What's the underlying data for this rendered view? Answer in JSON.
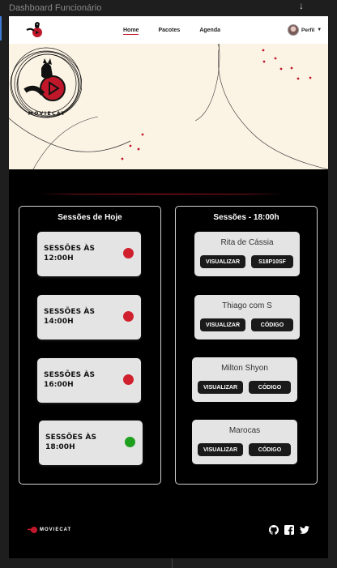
{
  "frame_label": "Dashboard Funcionário",
  "nav": {
    "links": [
      "Home",
      "Pacotes",
      "Agenda"
    ],
    "profile_label": "Perfil"
  },
  "brand": {
    "name": "MOVIECAT",
    "hero_wordmark": "MOVIECAT"
  },
  "colors": {
    "accent": "#c0182a",
    "status_busy": "#d0202e",
    "status_free": "#1ea01e"
  },
  "left_panel": {
    "title": "Sessões de Hoje",
    "sessions": [
      {
        "line1": "SESSÕES ÀS",
        "line2": "12:00H",
        "status": "busy"
      },
      {
        "line1": "SESSÕES ÀS",
        "line2": "14:00H",
        "status": "busy"
      },
      {
        "line1": "SESSÕES ÀS",
        "line2": "16:00H",
        "status": "busy"
      },
      {
        "line1": "SESSÕES ÀS",
        "line2": "18:00H",
        "status": "free"
      }
    ]
  },
  "right_panel": {
    "title": "Sessões - 18:00h",
    "people": [
      {
        "name": "Rita de Cássia",
        "view_label": "VISUALIZAR",
        "code_label": "S18P10SF"
      },
      {
        "name": "Thiago com S",
        "view_label": "VISUALIZAR",
        "code_label": "CÓDIGO"
      },
      {
        "name": "Milton Shyon",
        "view_label": "VISUALIZAR",
        "code_label": "CÓDIGO"
      },
      {
        "name": "Marocas",
        "view_label": "VISUALIZAR",
        "code_label": "CÓDIGO"
      }
    ]
  },
  "footer": {
    "brand": "MOVIECAT",
    "social_icons": [
      "github-icon",
      "facebook-icon",
      "twitter-icon"
    ]
  }
}
